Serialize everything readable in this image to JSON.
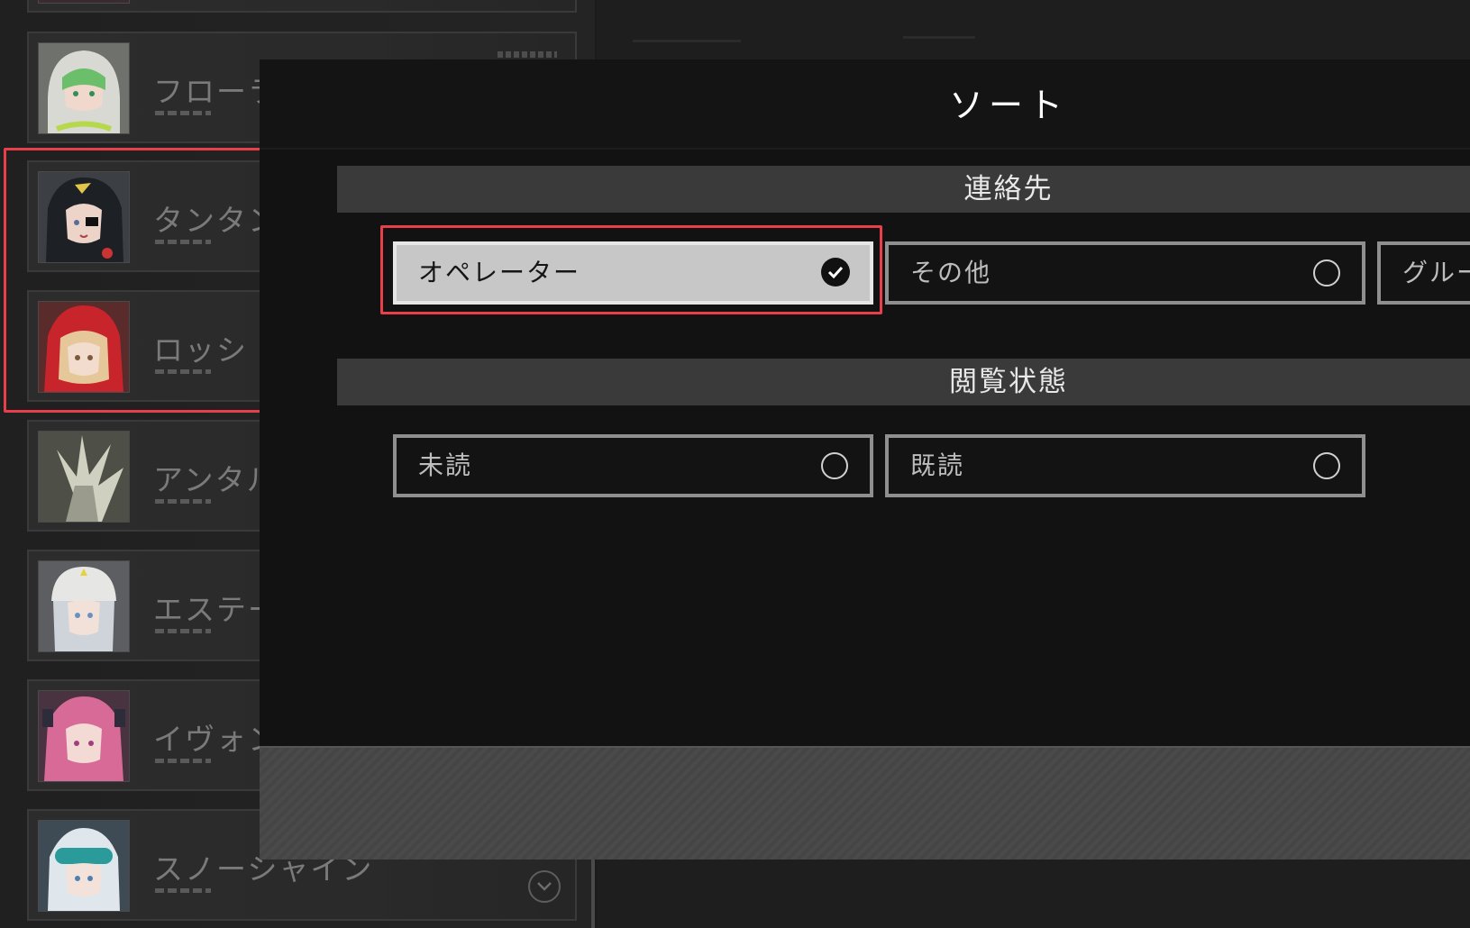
{
  "contacts": [
    {
      "name": "",
      "avatar": "partial-top-avatar"
    },
    {
      "name": "フローラ",
      "avatar": "white-hood-green-hair",
      "tag": true
    },
    {
      "name": "タンタン",
      "avatar": "dark-hair-eyepatch"
    },
    {
      "name": "ロッシ",
      "avatar": "red-hood-blonde"
    },
    {
      "name": "アンタル",
      "avatar": "white-spiky-creature"
    },
    {
      "name": "エステー",
      "avatar": "white-cap-silver-hair"
    },
    {
      "name": "イヴォン",
      "avatar": "pink-hair"
    },
    {
      "name": "スノーシャイン",
      "avatar": "goggles-blue-hair",
      "expand_icon": "chevron-down-icon"
    }
  ],
  "sort_dialog": {
    "title": "ソート",
    "sections": [
      {
        "label": "連絡先",
        "options": [
          {
            "label": "オペレーター",
            "selected": true
          },
          {
            "label": "その他",
            "selected": false
          },
          {
            "label": "グルー",
            "selected": false
          }
        ]
      },
      {
        "label": "閲覧状態",
        "options": [
          {
            "label": "未読",
            "selected": false
          },
          {
            "label": "既読",
            "selected": false
          }
        ]
      }
    ]
  },
  "colors": {
    "highlight": "#e8404a",
    "selected_option_bg": "#c7c7c7",
    "dialog_bg": "#121212",
    "section_bar": "#3a3a3a"
  }
}
